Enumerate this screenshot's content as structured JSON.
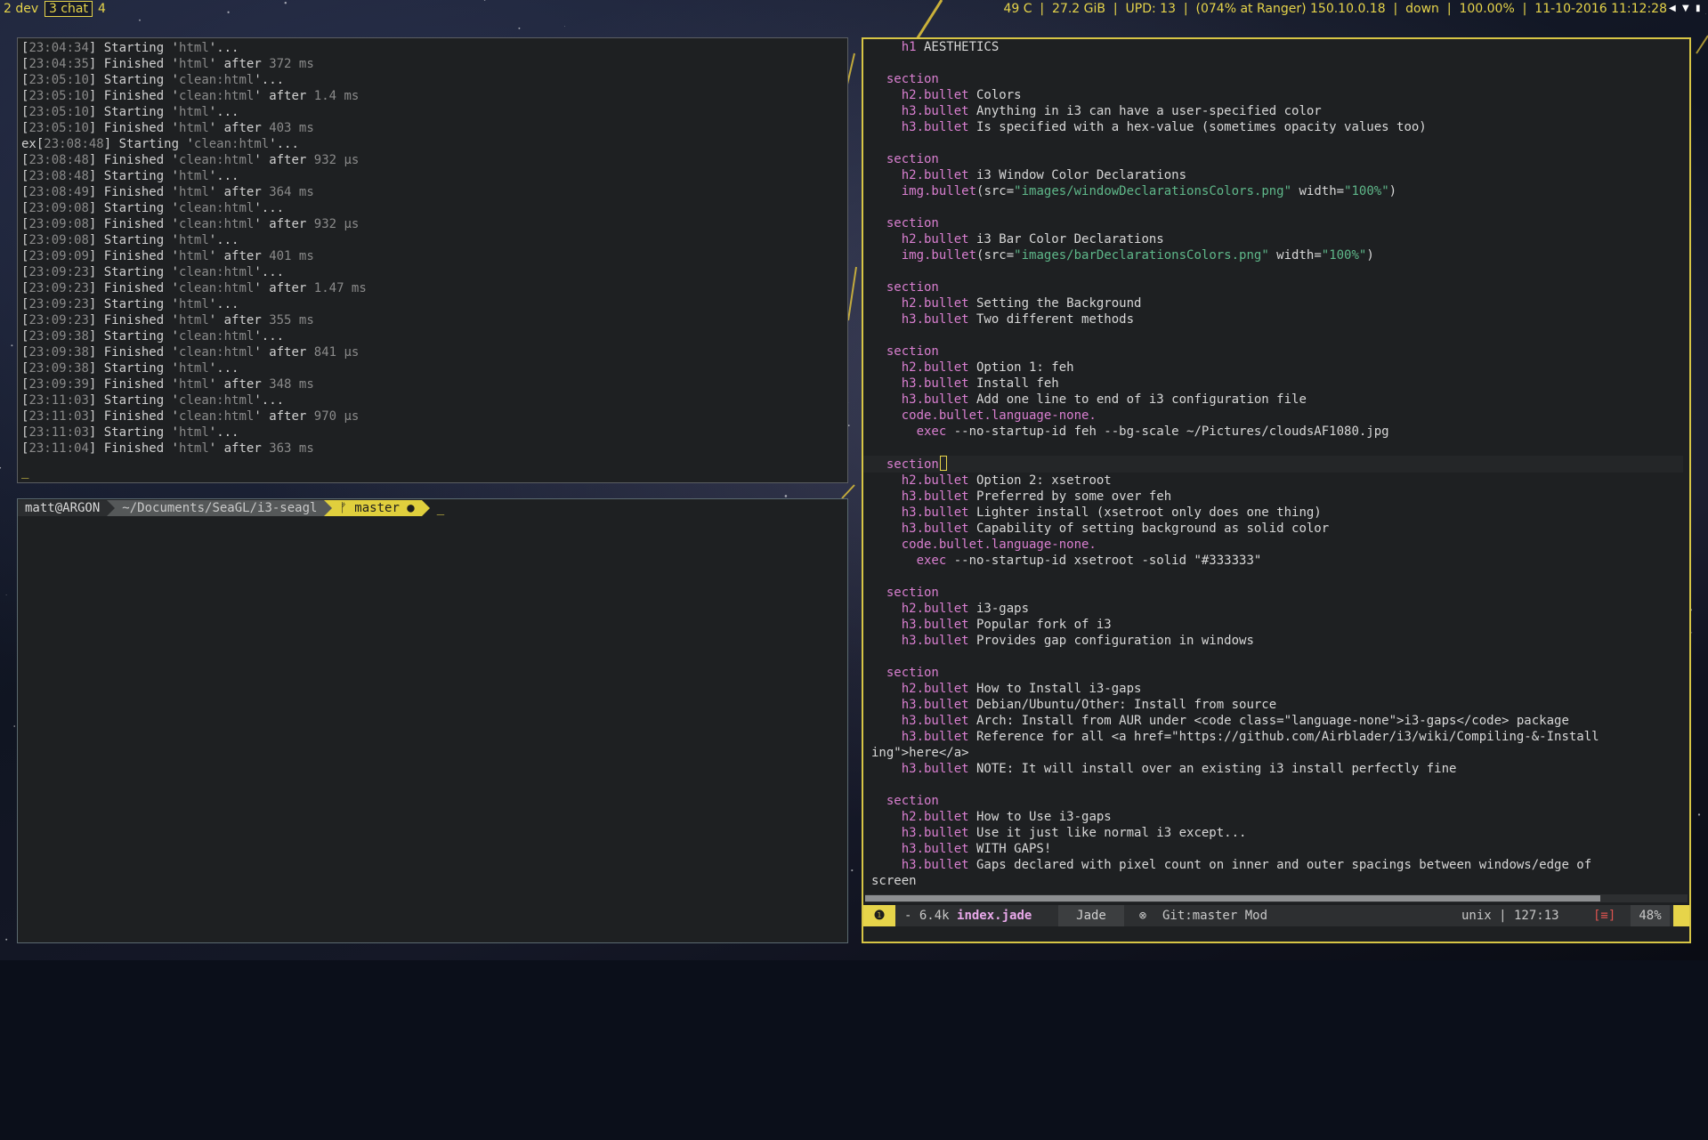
{
  "workspaces": [
    {
      "label": "2 dev",
      "focused": false
    },
    {
      "label": "3 chat",
      "focused": true
    },
    {
      "label": "4",
      "focused": false
    }
  ],
  "status_bar": {
    "temperature": "49 C",
    "disk": "27.2 GiB",
    "updates": "UPD: 13",
    "wifi": "(074% at Ranger) 150.10.0.18",
    "ethernet": "down",
    "volume": "100.00%",
    "datetime": "11-10-2016 11:12:28"
  },
  "log_terminal": {
    "lines": [
      {
        "prefix": "",
        "ts": "23:04:34",
        "verb": "Starting",
        "task": "html",
        "suffix": "..."
      },
      {
        "prefix": "",
        "ts": "23:04:35",
        "verb": "Finished",
        "task": "html",
        "suffix": "after",
        "dur": "372 ms"
      },
      {
        "prefix": "",
        "ts": "23:05:10",
        "verb": "Starting",
        "task": "clean:html",
        "suffix": "..."
      },
      {
        "prefix": "",
        "ts": "23:05:10",
        "verb": "Finished",
        "task": "clean:html",
        "suffix": "after",
        "dur": "1.4 ms"
      },
      {
        "prefix": "",
        "ts": "23:05:10",
        "verb": "Starting",
        "task": "html",
        "suffix": "..."
      },
      {
        "prefix": "",
        "ts": "23:05:10",
        "verb": "Finished",
        "task": "html",
        "suffix": "after",
        "dur": "403 ms"
      },
      {
        "prefix": "ex",
        "ts": "23:08:48",
        "verb": "Starting",
        "task": "clean:html",
        "suffix": "..."
      },
      {
        "prefix": "",
        "ts": "23:08:48",
        "verb": "Finished",
        "task": "clean:html",
        "suffix": "after",
        "dur": "932 μs"
      },
      {
        "prefix": "",
        "ts": "23:08:48",
        "verb": "Starting",
        "task": "html",
        "suffix": "..."
      },
      {
        "prefix": "",
        "ts": "23:08:49",
        "verb": "Finished",
        "task": "html",
        "suffix": "after",
        "dur": "364 ms"
      },
      {
        "prefix": "",
        "ts": "23:09:08",
        "verb": "Starting",
        "task": "clean:html",
        "suffix": "..."
      },
      {
        "prefix": "",
        "ts": "23:09:08",
        "verb": "Finished",
        "task": "clean:html",
        "suffix": "after",
        "dur": "932 μs"
      },
      {
        "prefix": "",
        "ts": "23:09:08",
        "verb": "Starting",
        "task": "html",
        "suffix": "..."
      },
      {
        "prefix": "",
        "ts": "23:09:09",
        "verb": "Finished",
        "task": "html",
        "suffix": "after",
        "dur": "401 ms"
      },
      {
        "prefix": "",
        "ts": "23:09:23",
        "verb": "Starting",
        "task": "clean:html",
        "suffix": "..."
      },
      {
        "prefix": "",
        "ts": "23:09:23",
        "verb": "Finished",
        "task": "clean:html",
        "suffix": "after",
        "dur": "1.47 ms"
      },
      {
        "prefix": "",
        "ts": "23:09:23",
        "verb": "Starting",
        "task": "html",
        "suffix": "..."
      },
      {
        "prefix": "",
        "ts": "23:09:23",
        "verb": "Finished",
        "task": "html",
        "suffix": "after",
        "dur": "355 ms"
      },
      {
        "prefix": "",
        "ts": "23:09:38",
        "verb": "Starting",
        "task": "clean:html",
        "suffix": "..."
      },
      {
        "prefix": "",
        "ts": "23:09:38",
        "verb": "Finished",
        "task": "clean:html",
        "suffix": "after",
        "dur": "841 μs"
      },
      {
        "prefix": "",
        "ts": "23:09:38",
        "verb": "Starting",
        "task": "html",
        "suffix": "..."
      },
      {
        "prefix": "",
        "ts": "23:09:39",
        "verb": "Finished",
        "task": "html",
        "suffix": "after",
        "dur": "348 ms"
      },
      {
        "prefix": "",
        "ts": "23:11:03",
        "verb": "Starting",
        "task": "clean:html",
        "suffix": "..."
      },
      {
        "prefix": "",
        "ts": "23:11:03",
        "verb": "Finished",
        "task": "clean:html",
        "suffix": "after",
        "dur": "970 μs"
      },
      {
        "prefix": "",
        "ts": "23:11:03",
        "verb": "Starting",
        "task": "html",
        "suffix": "..."
      },
      {
        "prefix": "",
        "ts": "23:11:04",
        "verb": "Finished",
        "task": "html",
        "suffix": "after",
        "dur": "363 ms"
      }
    ],
    "cursor": "_"
  },
  "shell_prompt": {
    "user_host": "matt@ARGON",
    "path": "~/Documents/SeaGL/i3-seagl",
    "branch_icon": "ᚠ",
    "branch": "master ●",
    "cursor": "_"
  },
  "editor": {
    "lines": [
      [
        {
          "t": "    "
        },
        {
          "t": "h1",
          "c": "kw"
        },
        {
          "t": " AESTHETICS"
        }
      ],
      [],
      [
        {
          "t": "  "
        },
        {
          "t": "section",
          "c": "kw"
        }
      ],
      [
        {
          "t": "    "
        },
        {
          "t": "h2.bullet",
          "c": "kw"
        },
        {
          "t": " Colors"
        }
      ],
      [
        {
          "t": "    "
        },
        {
          "t": "h3.bullet",
          "c": "kw"
        },
        {
          "t": " Anything in i3 can have a user-specified color"
        }
      ],
      [
        {
          "t": "    "
        },
        {
          "t": "h3.bullet",
          "c": "kw"
        },
        {
          "t": " Is specified with a hex-value (sometimes opacity values too)"
        }
      ],
      [],
      [
        {
          "t": "  "
        },
        {
          "t": "section",
          "c": "kw"
        }
      ],
      [
        {
          "t": "    "
        },
        {
          "t": "h2.bullet",
          "c": "kw"
        },
        {
          "t": " i3 Window Color Declarations"
        }
      ],
      [
        {
          "t": "    "
        },
        {
          "t": "img.bullet",
          "c": "kw"
        },
        {
          "t": "(src="
        },
        {
          "t": "\"images/windowDeclarationsColors.png\"",
          "c": "str"
        },
        {
          "t": " width="
        },
        {
          "t": "\"100%\"",
          "c": "str"
        },
        {
          "t": ")"
        }
      ],
      [],
      [
        {
          "t": "  "
        },
        {
          "t": "section",
          "c": "kw"
        }
      ],
      [
        {
          "t": "    "
        },
        {
          "t": "h2.bullet",
          "c": "kw"
        },
        {
          "t": " i3 Bar Color Declarations"
        }
      ],
      [
        {
          "t": "    "
        },
        {
          "t": "img.bullet",
          "c": "kw"
        },
        {
          "t": "(src="
        },
        {
          "t": "\"images/barDeclarationsColors.png\"",
          "c": "str"
        },
        {
          "t": " width="
        },
        {
          "t": "\"100%\"",
          "c": "str"
        },
        {
          "t": ")"
        }
      ],
      [],
      [
        {
          "t": "  "
        },
        {
          "t": "section",
          "c": "kw"
        }
      ],
      [
        {
          "t": "    "
        },
        {
          "t": "h2.bullet",
          "c": "kw"
        },
        {
          "t": " Setting the Background"
        }
      ],
      [
        {
          "t": "    "
        },
        {
          "t": "h3.bullet",
          "c": "kw"
        },
        {
          "t": " Two different methods"
        }
      ],
      [],
      [
        {
          "t": "  "
        },
        {
          "t": "section",
          "c": "kw"
        }
      ],
      [
        {
          "t": "    "
        },
        {
          "t": "h2.bullet",
          "c": "kw"
        },
        {
          "t": " Option 1: feh"
        }
      ],
      [
        {
          "t": "    "
        },
        {
          "t": "h3.bullet",
          "c": "kw"
        },
        {
          "t": " Install feh"
        }
      ],
      [
        {
          "t": "    "
        },
        {
          "t": "h3.bullet",
          "c": "kw"
        },
        {
          "t": " Add one line to end of i3 configuration file"
        }
      ],
      [
        {
          "t": "    "
        },
        {
          "t": "code.bullet.language-none.",
          "c": "kw"
        }
      ],
      [
        {
          "t": "      "
        },
        {
          "t": "exec",
          "c": "kw"
        },
        {
          "t": " --no-startup-id feh --bg-scale ~/Pictures/cloudsAF1080.jpg"
        }
      ],
      [],
      [
        {
          "t": "  "
        },
        {
          "t": "section",
          "c": "kw"
        },
        {
          "t": "",
          "cur": true
        }
      ],
      [
        {
          "t": "    "
        },
        {
          "t": "h2.bullet",
          "c": "kw"
        },
        {
          "t": " Option 2: xsetroot"
        }
      ],
      [
        {
          "t": "    "
        },
        {
          "t": "h3.bullet",
          "c": "kw"
        },
        {
          "t": " Preferred by some over feh"
        }
      ],
      [
        {
          "t": "    "
        },
        {
          "t": "h3.bullet",
          "c": "kw"
        },
        {
          "t": " Lighter install (xsetroot only does one thing)"
        }
      ],
      [
        {
          "t": "    "
        },
        {
          "t": "h3.bullet",
          "c": "kw"
        },
        {
          "t": " Capability of setting background as solid color"
        }
      ],
      [
        {
          "t": "    "
        },
        {
          "t": "code.bullet.language-none.",
          "c": "kw"
        }
      ],
      [
        {
          "t": "      "
        },
        {
          "t": "exec",
          "c": "kw"
        },
        {
          "t": " --no-startup-id xsetroot -solid \"#333333\""
        }
      ],
      [],
      [
        {
          "t": "  "
        },
        {
          "t": "section",
          "c": "kw"
        }
      ],
      [
        {
          "t": "    "
        },
        {
          "t": "h2.bullet",
          "c": "kw"
        },
        {
          "t": " i3-gaps"
        }
      ],
      [
        {
          "t": "    "
        },
        {
          "t": "h3.bullet",
          "c": "kw"
        },
        {
          "t": " Popular fork of i3"
        }
      ],
      [
        {
          "t": "    "
        },
        {
          "t": "h3.bullet",
          "c": "kw"
        },
        {
          "t": " Provides gap configuration in windows"
        }
      ],
      [],
      [
        {
          "t": "  "
        },
        {
          "t": "section",
          "c": "kw"
        }
      ],
      [
        {
          "t": "    "
        },
        {
          "t": "h2.bullet",
          "c": "kw"
        },
        {
          "t": " How to Install i3-gaps"
        }
      ],
      [
        {
          "t": "    "
        },
        {
          "t": "h3.bullet",
          "c": "kw"
        },
        {
          "t": " Debian/Ubuntu/Other: Install from source"
        }
      ],
      [
        {
          "t": "    "
        },
        {
          "t": "h3.bullet",
          "c": "kw"
        },
        {
          "t": " Arch: Install from AUR under <code class=\"language-none\">i3-gaps</code> package"
        }
      ],
      [
        {
          "t": "    "
        },
        {
          "t": "h3.bullet",
          "c": "kw"
        },
        {
          "t": " Reference for all <a href=\"https://github.com/Airblader/i3/wiki/Compiling-&-Install"
        }
      ],
      [
        {
          "t": "ing\">here</a>"
        }
      ],
      [
        {
          "t": "    "
        },
        {
          "t": "h3.bullet",
          "c": "kw"
        },
        {
          "t": " NOTE: It will install over an existing i3 install perfectly fine"
        }
      ],
      [],
      [
        {
          "t": "  "
        },
        {
          "t": "section",
          "c": "kw"
        }
      ],
      [
        {
          "t": "    "
        },
        {
          "t": "h2.bullet",
          "c": "kw"
        },
        {
          "t": " How to Use i3-gaps"
        }
      ],
      [
        {
          "t": "    "
        },
        {
          "t": "h3.bullet",
          "c": "kw"
        },
        {
          "t": " Use it just like normal i3 except..."
        }
      ],
      [
        {
          "t": "    "
        },
        {
          "t": "h3.bullet",
          "c": "kw"
        },
        {
          "t": " WITH GAPS!"
        }
      ],
      [
        {
          "t": "    "
        },
        {
          "t": "h3.bullet",
          "c": "kw"
        },
        {
          "t": " Gaps declared with pixel count on inner and outer spacings between windows/edge of"
        }
      ],
      [
        {
          "t": "screen"
        }
      ]
    ],
    "statusline": {
      "warn_icon": "❶",
      "size": "- 6.4k",
      "filename": "index.jade",
      "filetype": "Jade",
      "icon": "⊗",
      "git": "Git:master Mod",
      "format": "unix | 127:13",
      "trail": "[≡]",
      "percent": "48%"
    }
  },
  "colors": {
    "accent": "#e6d44a",
    "keyword": "#d97fd0",
    "string": "#5fb88a",
    "terminal_bg": "#1e2022"
  }
}
